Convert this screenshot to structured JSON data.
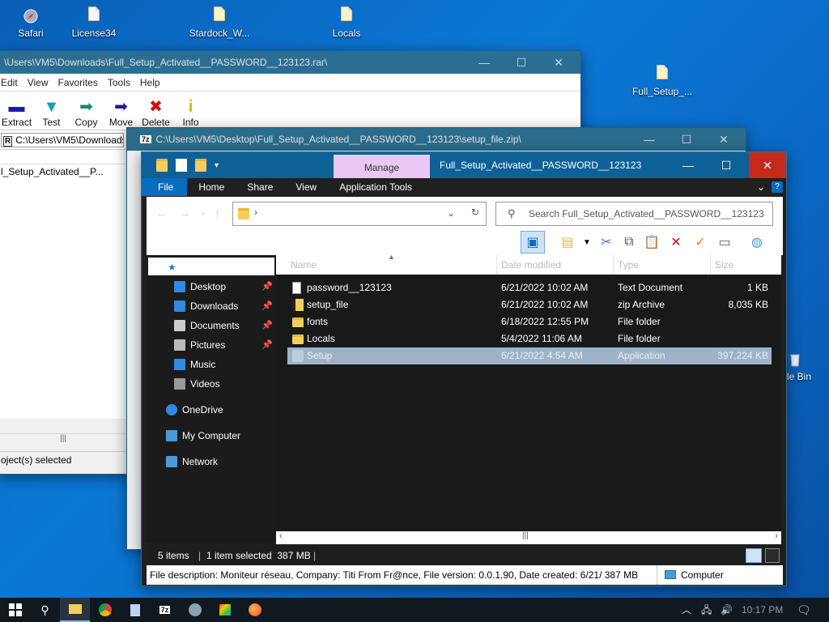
{
  "desktop": {
    "icons": [
      {
        "label": "Safari",
        "icon": "safari-globe-icon"
      },
      {
        "label": "License34",
        "icon": "document-icon"
      },
      {
        "label": "Stardock_W...",
        "icon": "document-icon"
      },
      {
        "label": "Locals",
        "icon": "document-icon"
      },
      {
        "label": "Full_Setup_...",
        "icon": "document-icon"
      },
      {
        "label": "le Bin",
        "icon": "recycle-bin-icon"
      }
    ]
  },
  "rar_window": {
    "title": "\\Users\\VM5\\Downloads\\Full_Setup_Activated__PASSWORD__123123.rar\\",
    "menu": [
      "Edit",
      "View",
      "Favorites",
      "Tools",
      "Help"
    ],
    "toolbar": [
      {
        "label": "Extract",
        "icon": "extract-icon",
        "color": "#1a1aa8"
      },
      {
        "label": "Test",
        "icon": "test-icon",
        "color": "#13a0b8"
      },
      {
        "label": "Copy",
        "icon": "copy-arrow-icon",
        "color": "#1a8a6a"
      },
      {
        "label": "Move",
        "icon": "move-arrow-icon",
        "color": "#1a1aa8"
      },
      {
        "label": "Delete",
        "icon": "delete-x-icon",
        "color": "#d01010"
      },
      {
        "label": "Info",
        "icon": "info-icon",
        "color": "#d7b700"
      }
    ],
    "address": "C:\\Users\\VM5\\Downloads",
    "list_item": "l_Setup_Activated__P...",
    "status": "oject(s) selected",
    "minimize": "—",
    "maximize": "☐",
    "close": "✕"
  },
  "zip_window": {
    "title": "C:\\Users\\VM5\\Desktop\\Full_Setup_Activated__PASSWORD__123123\\setup_file.zip\\",
    "app_icon": "7z",
    "minimize": "—",
    "maximize": "☐",
    "close": "✕"
  },
  "explorer": {
    "title": "Full_Setup_Activated__PASSWORD__123123",
    "manage_tab": "Manage",
    "ribbon_tabs": [
      "File",
      "Home",
      "Share",
      "View",
      "Application Tools"
    ],
    "minimize": "—",
    "maximize": "☐",
    "close": "✕",
    "path_text": "›",
    "search_placeholder": "Search Full_Setup_Activated__PASSWORD__123123",
    "columns": [
      "Name",
      "Date modified",
      "Type",
      "Size"
    ],
    "files": [
      {
        "name": "password__123123",
        "date": "6/21/2022 10:02 AM",
        "type": "Text Document",
        "size": "1 KB",
        "icon": "text-document-icon",
        "selected": false
      },
      {
        "name": "setup_file",
        "date": "6/21/2022 10:02 AM",
        "type": "zip Archive",
        "size": "8,035 KB",
        "icon": "zip-archive-icon",
        "selected": false
      },
      {
        "name": "fonts",
        "date": "6/18/2022 12:55 PM",
        "type": "File folder",
        "size": "",
        "icon": "folder-icon",
        "selected": false
      },
      {
        "name": "Locals",
        "date": "5/4/2022 11:06 AM",
        "type": "File folder",
        "size": "",
        "icon": "folder-icon",
        "selected": false
      },
      {
        "name": "Setup",
        "date": "6/21/2022 4:54 AM",
        "type": "Application",
        "size": "397,224 KB",
        "icon": "application-icon",
        "selected": true
      }
    ],
    "nav": [
      {
        "label": "Quick access",
        "icon": "star-icon",
        "pinned": false,
        "indent": 1
      },
      {
        "label": "Desktop",
        "icon": "desktop-icon",
        "pinned": true,
        "indent": 2
      },
      {
        "label": "Downloads",
        "icon": "download-icon",
        "pinned": true,
        "indent": 2
      },
      {
        "label": "Documents",
        "icon": "documents-icon",
        "pinned": true,
        "indent": 2
      },
      {
        "label": "Pictures",
        "icon": "pictures-icon",
        "pinned": true,
        "indent": 2
      },
      {
        "label": "Music",
        "icon": "music-icon",
        "pinned": false,
        "indent": 2
      },
      {
        "label": "Videos",
        "icon": "videos-icon",
        "pinned": false,
        "indent": 2
      },
      {
        "label": "OneDrive",
        "icon": "onedrive-icon",
        "pinned": false,
        "indent": 1
      },
      {
        "label": "My Computer",
        "icon": "computer-icon",
        "pinned": false,
        "indent": 1
      },
      {
        "label": "Network",
        "icon": "network-icon",
        "pinned": false,
        "indent": 1
      }
    ],
    "status_items": "5 items",
    "status_selected": "1 item selected  387 MB",
    "status_sep": "|",
    "info_text": "File description: Moniteur réseau, Company: Titi From Fr@nce, File version: 0.0.1.90, Date created: 6/21/ 387 MB",
    "info_location": "Computer"
  },
  "taskbar": {
    "items": [
      "start-icon",
      "search-icon",
      "file-explorer-icon",
      "chrome-icon",
      "notepad-icon",
      "7zip-icon",
      "globe-app-icon",
      "paint-icon",
      "firefox-icon"
    ],
    "clock": "10:17 PM",
    "tray_icons": [
      "chevron-up-icon",
      "network-tray-icon",
      "volume-icon"
    ],
    "notification_icon": "notification-icon"
  },
  "colors": {
    "desktop": "#0b6cc8",
    "explorer_title": "#0e6196",
    "manage_tab": "#e9c8f3",
    "file_tab": "#0b6cbd",
    "selection": "#9fb3c8"
  }
}
